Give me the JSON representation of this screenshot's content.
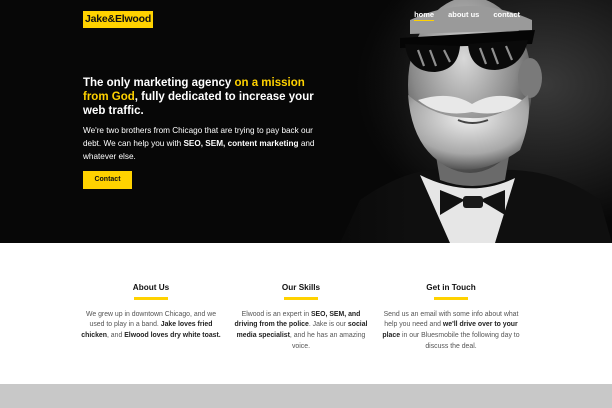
{
  "brand": {
    "logo_text": "Jake&Elwood",
    "accent_color": "#ffd200"
  },
  "nav": {
    "items": [
      {
        "label": "home",
        "active": true
      },
      {
        "label": "about us",
        "active": false
      },
      {
        "label": "contact",
        "active": false
      }
    ]
  },
  "hero": {
    "headline_part1": "The only marketing agency ",
    "headline_highlight": "on a mission from God",
    "headline_part2": ", fully dedicated to increase your web traffic.",
    "intro_text": "We're two brothers from Chicago that are trying to pay back our debt. We can help you with ",
    "intro_bold": "SEO, SEM, content marketing",
    "intro_tail": " and whatever else.",
    "cta_label": "Contact"
  },
  "features": [
    {
      "title": "About Us",
      "segments": [
        {
          "text": "We grew up in downtown Chicago, and we used to play in a band. ",
          "bold": false
        },
        {
          "text": "Jake loves fried chicken",
          "bold": true
        },
        {
          "text": ", and ",
          "bold": false
        },
        {
          "text": "Elwood loves dry white toast.",
          "bold": true
        }
      ]
    },
    {
      "title": "Our Skills",
      "segments": [
        {
          "text": "Elwood is an expert in ",
          "bold": false
        },
        {
          "text": "SEO, SEM, and driving from the police",
          "bold": true
        },
        {
          "text": ". Jake is our ",
          "bold": false
        },
        {
          "text": "social media specialist",
          "bold": true
        },
        {
          "text": ", and he has an amazing voice.",
          "bold": false
        }
      ]
    },
    {
      "title": "Get in Touch",
      "segments": [
        {
          "text": "Send us an email with some info about what help you need and ",
          "bold": false
        },
        {
          "text": "we'll drive over to your place",
          "bold": true
        },
        {
          "text": " in our Bluesmobile the following day to discuss the deal.",
          "bold": false
        }
      ]
    }
  ]
}
